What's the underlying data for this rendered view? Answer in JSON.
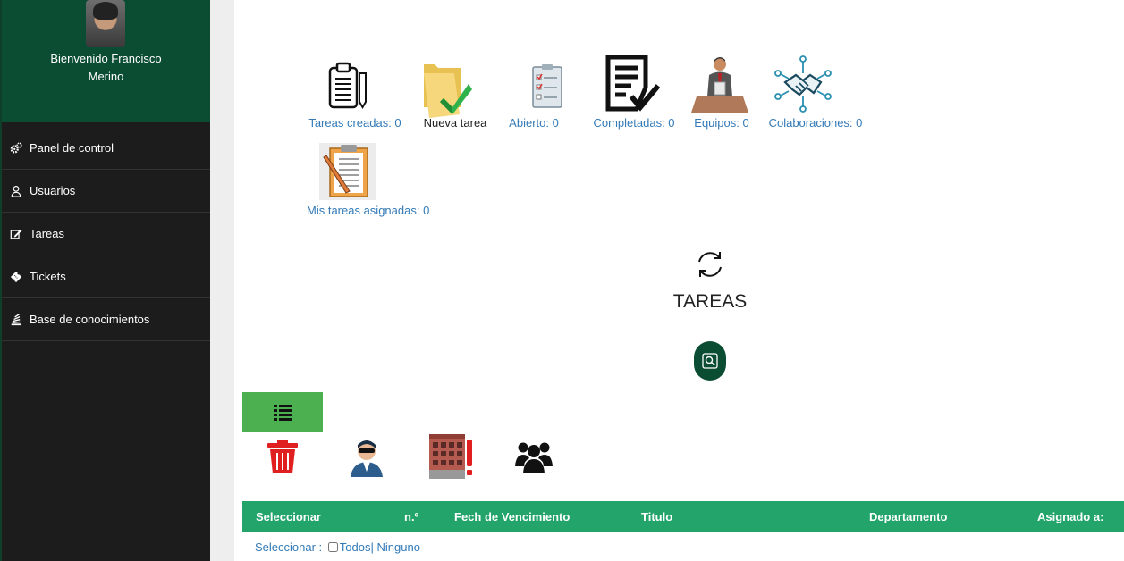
{
  "sidebar": {
    "welcome_line1": "Bienvenido Francisco",
    "welcome_line2": "Merino",
    "items": [
      {
        "label": "Panel de control",
        "icon": "gears-icon"
      },
      {
        "label": "Usuarios",
        "icon": "user-icon"
      },
      {
        "label": "Tareas",
        "icon": "edit-icon"
      },
      {
        "label": "Tickets",
        "icon": "ticket-icon"
      },
      {
        "label": "Base de conocimientos",
        "icon": "stack-icon"
      }
    ]
  },
  "dashboard": {
    "created": "Tareas creadas: 0",
    "new_task": "Nueva tarea",
    "open": "Abierto: 0",
    "completed": "Completadas: 0",
    "teams": "Equipos: 0",
    "collaborations": "Colaboraciones: 0",
    "assigned": "Mis tareas asignadas: 0"
  },
  "main": {
    "title": "TAREAS"
  },
  "table": {
    "headers": [
      "Seleccionar",
      "n.º",
      "Fech de Vencimiento",
      "Titulo",
      "Departamento",
      "Asignado a:"
    ]
  },
  "select_row": {
    "prefix": "Seleccionar :",
    "all": "Todos",
    "separator": "|",
    "none": "Ninguno"
  },
  "colors": {
    "sidebar_bg": "#1c1c1c",
    "profile_bg": "#0b4d32",
    "header_green": "#22a46b",
    "link_blue": "#337ab7",
    "list_button_green": "#4caf50"
  }
}
